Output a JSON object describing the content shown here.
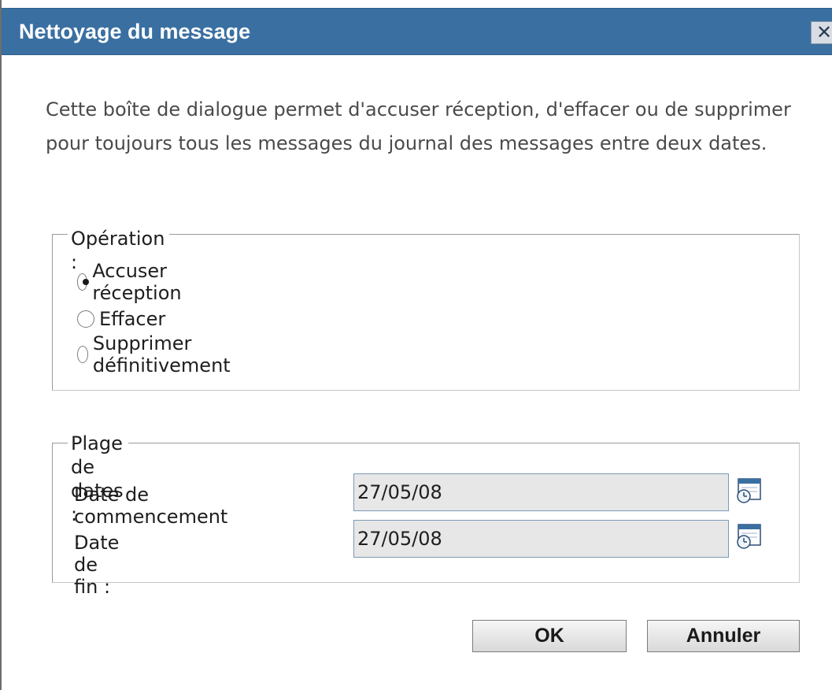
{
  "dialog": {
    "title": "Nettoyage du message",
    "close_glyph": "✕",
    "intro_text": "Cette boîte de dialogue permet d'accuser réception, d'effacer ou de supprimer pour toujours tous les messages du journal des messages entre deux dates."
  },
  "operation": {
    "legend": "Opération :",
    "options": [
      {
        "label": "Accuser réception",
        "checked": true
      },
      {
        "label": "Effacer",
        "checked": false
      },
      {
        "label": "Supprimer définitivement",
        "checked": false
      }
    ]
  },
  "date_range": {
    "legend": "Plage de dates :",
    "start_label": "Date de commencement :",
    "start_value": "27/05/08",
    "end_label": "Date de fin :",
    "end_value": "27/05/08",
    "calendar_icon": "calendar-clock-icon"
  },
  "buttons": {
    "ok_label": "OK",
    "cancel_label": "Annuler"
  },
  "colors": {
    "titlebar": "#3a6fa1",
    "field_bg": "#e7e7e7",
    "field_border": "#7d99b6"
  }
}
